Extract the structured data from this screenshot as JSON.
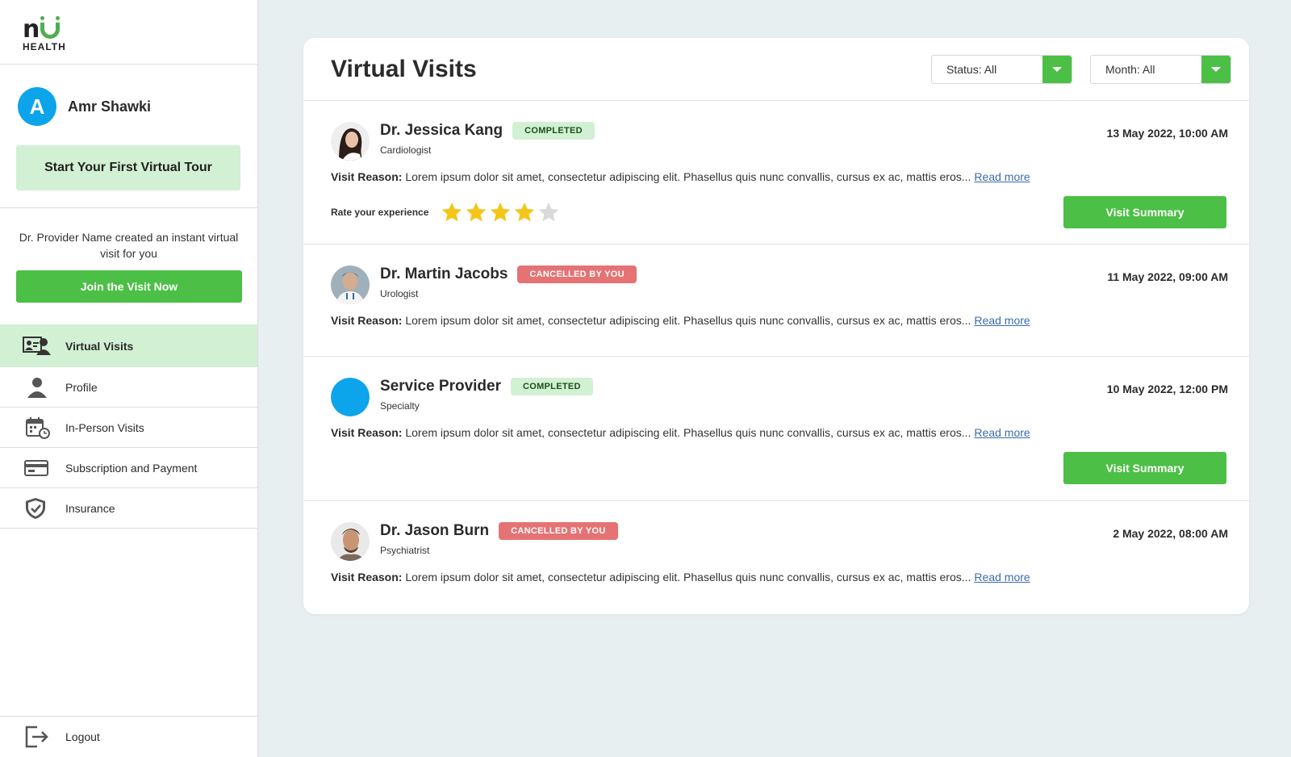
{
  "brand": {
    "logo_text": "HEALTH"
  },
  "user": {
    "initial": "A",
    "name": "Amr Shawki"
  },
  "tour_button": "Start Your First Virtual Tour",
  "notice": {
    "text": "Dr. Provider Name created an instant virtual visit for you",
    "button": "Join the Visit Now"
  },
  "nav": [
    {
      "label": "Virtual Visits",
      "icon": "virtual-visits-icon",
      "active": true
    },
    {
      "label": "Profile",
      "icon": "person-icon"
    },
    {
      "label": "In-Person Visits",
      "icon": "calendar-clock-icon"
    },
    {
      "label": "Subscription and Payment",
      "icon": "credit-card-icon"
    },
    {
      "label": "Insurance",
      "icon": "shield-icon"
    }
  ],
  "logout": "Logout",
  "page": {
    "title": "Virtual Visits",
    "filters": {
      "status": "Status: All",
      "month": "Month: All"
    }
  },
  "visits": [
    {
      "name": "Dr. Jessica Kang",
      "status": "COMPLETED",
      "specialty": "Cardiologist",
      "date": "13 May 2022, 10:00 AM",
      "reason_label": "Visit Reason:",
      "reason": "Lorem ipsum dolor sit amet, consectetur adipiscing elit. Phasellus quis nunc convallis, cursus ex ac, mattis eros...",
      "read_more": "Read more",
      "rate_label": "Rate your experience",
      "rating": 4,
      "rating_max": 5,
      "summary": "Visit Summary"
    },
    {
      "name": "Dr. Martin Jacobs",
      "status": "CANCELLED BY YOU",
      "specialty": "Urologist",
      "date": "11 May 2022, 09:00 AM",
      "reason_label": "Visit Reason:",
      "reason": "Lorem ipsum dolor sit amet, consectetur adipiscing elit. Phasellus quis nunc convallis, cursus ex ac, mattis eros...",
      "read_more": "Read more"
    },
    {
      "name": "Service Provider",
      "status": "COMPLETED",
      "specialty": "Specialty",
      "date": "10 May 2022, 12:00 PM",
      "reason_label": "Visit Reason:",
      "reason": "Lorem ipsum dolor sit amet, consectetur adipiscing elit. Phasellus quis nunc convallis, cursus ex ac, mattis eros...",
      "read_more": "Read more",
      "summary": "Visit Summary"
    },
    {
      "name": "Dr. Jason Burn",
      "status": "CANCELLED BY YOU",
      "specialty": "Psychiatrist",
      "date": "2 May 2022, 08:00 AM",
      "reason_label": "Visit Reason:",
      "reason": "Lorem ipsum dolor sit amet, consectetur adipiscing elit. Phasellus quis nunc convallis, cursus ex ac, mattis eros...",
      "read_more": "Read more"
    }
  ],
  "colors": {
    "accent": "#4cbf46",
    "accent_light": "#d2f0d3",
    "cancel": "#e57373",
    "avatar": "#0ca4ea",
    "star": "#f5c518"
  }
}
